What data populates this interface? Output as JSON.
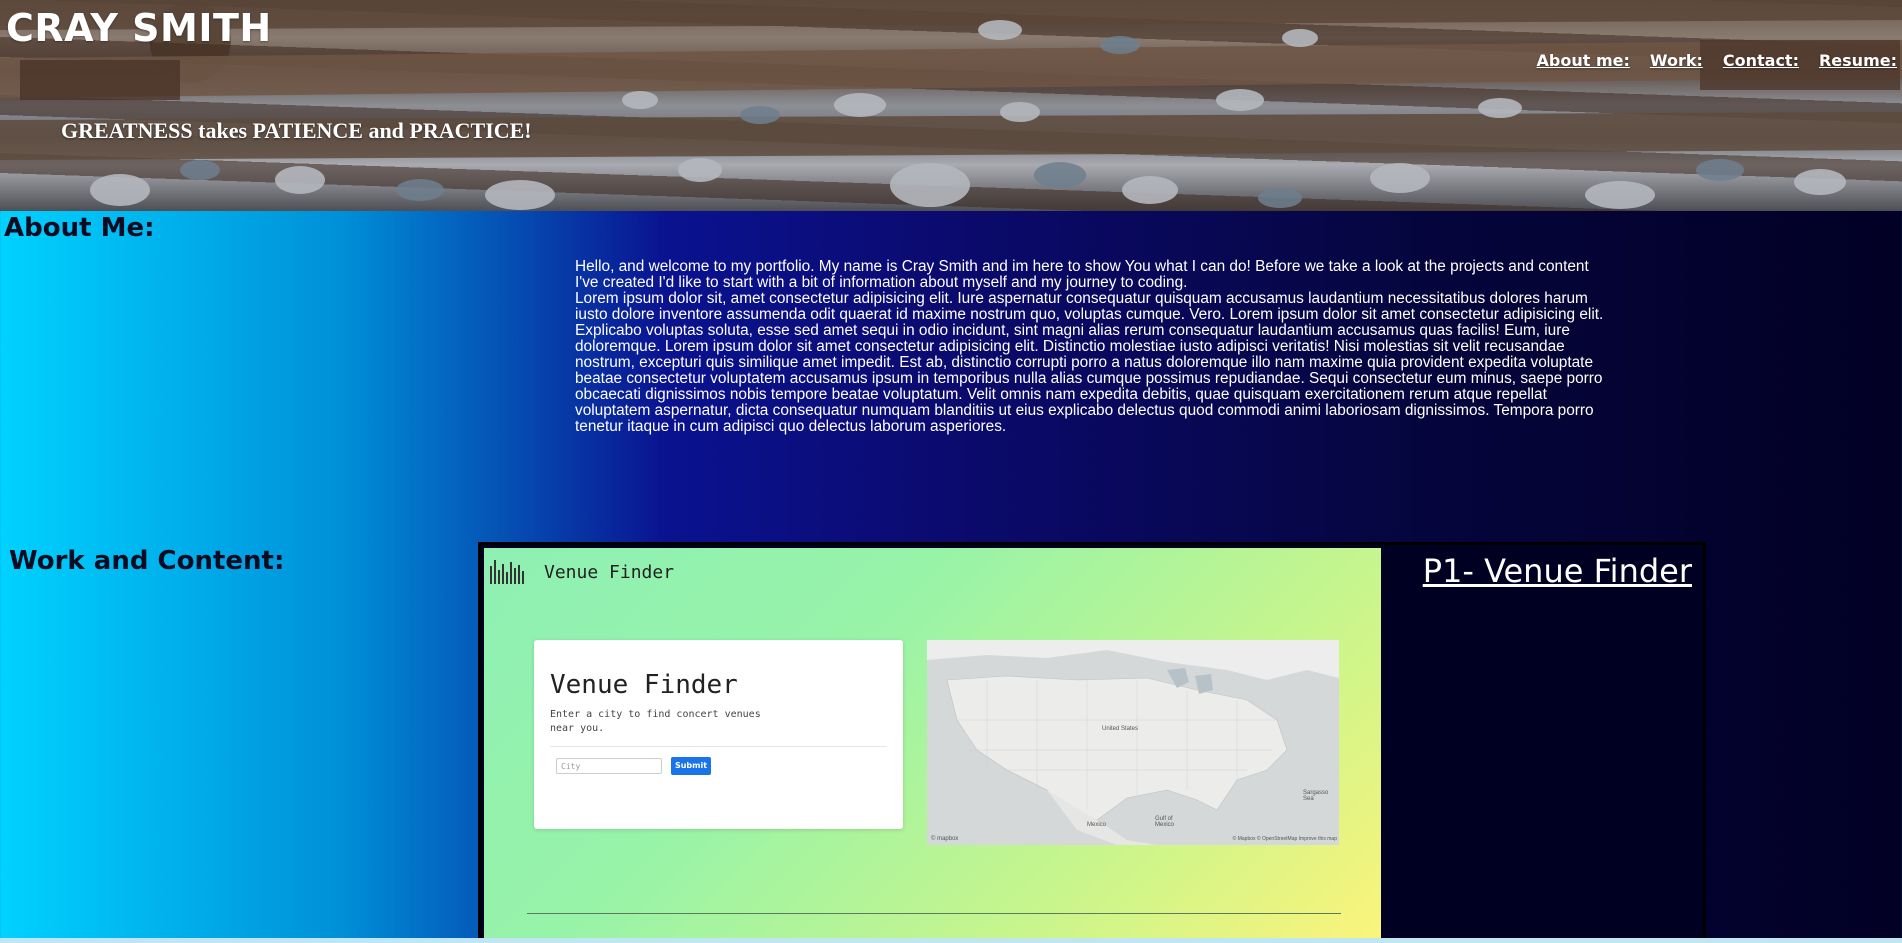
{
  "header": {
    "site_title": "CRAY SMITH",
    "tagline": "GREATNESS takes PATIENCE and PRACTICE!",
    "nav": [
      {
        "label": "About me:"
      },
      {
        "label": "Work:"
      },
      {
        "label": "Contact:"
      },
      {
        "label": "Resume:"
      }
    ]
  },
  "about": {
    "heading": "About Me:",
    "intro": "Hello, and welcome to my portfolio. My name is Cray Smith and im here to show You what I can do! Before we take a look at the projects and content I've created I'd like to start with a bit of information about myself and my journey to coding.",
    "body": "Lorem ipsum dolor sit, amet consectetur adipisicing elit. Iure aspernatur consequatur quisquam accusamus laudantium necessitatibus dolores harum iusto dolore inventore assumenda odit quaerat id maxime nostrum quo, voluptas cumque. Vero. Lorem ipsum dolor sit amet consectetur adipisicing elit. Explicabo voluptas soluta, esse sed amet sequi in odio incidunt, sint magni alias rerum consequatur laudantium accusamus quas facilis! Eum, iure doloremque. Lorem ipsum dolor sit amet consectetur adipisicing elit. Distinctio molestiae iusto adipisci veritatis! Nisi molestias sit velit recusandae nostrum, excepturi quis similique amet impedit. Est ab, distinctio corrupti porro a natus doloremque illo nam maxime quia provident expedita voluptate beatae consectetur voluptatem accusamus ipsum in temporibus nulla alias cumque possimus repudiandae. Sequi consectetur eum minus, saepe porro obcaecati dignissimos nobis tempore beatae voluptatum. Velit omnis nam expedita debitis, quae quisquam exercitationem rerum atque repellat voluptatem aspernatur, dicta consequatur numquam blanditiis ut eius explicabo delectus quod commodi animi laboriosam dignissimos. Tempora porro tenetur itaque in cum adipisci quo delectus laborum asperiores."
  },
  "work": {
    "heading": "Work and Content:",
    "projects": [
      {
        "link_label": "P1- Venue Finder",
        "screenshot": {
          "brand": "Venue Finder",
          "card_title": "Venue Finder",
          "card_subtitle": "Enter a city to find concert venues near you.",
          "input_placeholder": "City",
          "submit_label": "Submit",
          "map_labels": {
            "country": "United States",
            "mexico": "Mexico",
            "gulf": "Gulf of Mexico",
            "sea": "Sargasso Sea",
            "attribution": "© Mapbox © OpenStreetMap Improve this map",
            "mapbox": "© mapbox"
          }
        }
      }
    ]
  },
  "colors": {
    "gradient_start": "#00d2ff",
    "gradient_mid": "#0b0a6e",
    "gradient_end": "#020024",
    "text_light": "#ffffff",
    "submit_button": "#1a73e8"
  }
}
